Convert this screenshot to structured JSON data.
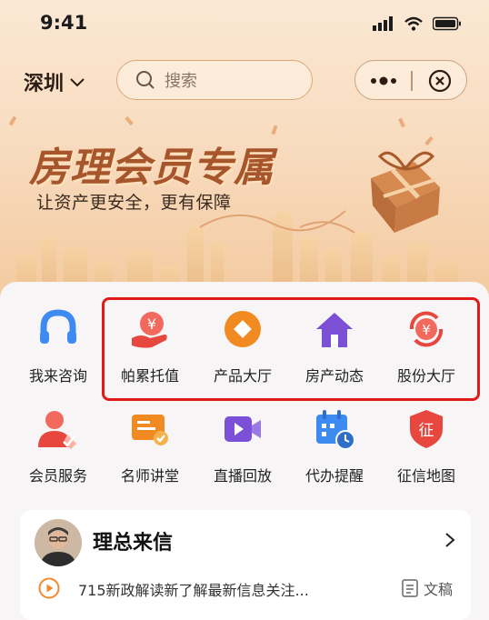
{
  "status_bar": {
    "time": "9:41"
  },
  "header": {
    "city": "深圳",
    "search_placeholder": "搜索"
  },
  "banner": {
    "title": "房理会员专属",
    "subtitle": "让资产更安全，更有保障"
  },
  "menu_row1": [
    {
      "label": "我来咨询",
      "icon": "headset-icon"
    },
    {
      "label": "帕累托值",
      "icon": "coin-hand-icon"
    },
    {
      "label": "产品大厅",
      "icon": "diamond-icon"
    },
    {
      "label": "房产动态",
      "icon": "house-icon"
    },
    {
      "label": "股份大厅",
      "icon": "yen-refresh-icon"
    }
  ],
  "menu_row2": [
    {
      "label": "会员服务",
      "icon": "member-icon"
    },
    {
      "label": "名师讲堂",
      "icon": "lecture-icon"
    },
    {
      "label": "直播回放",
      "icon": "video-icon"
    },
    {
      "label": "代办提醒",
      "icon": "calendar-clock-icon"
    },
    {
      "label": "征信地图",
      "icon": "credit-shield-icon"
    }
  ],
  "letter": {
    "title": "理总来信",
    "news": "715新政解读新了解最新信息关注...",
    "doc_label": "文稿"
  },
  "colors": {
    "accent_orange": "#f08a2c",
    "accent_red": "#e8473f",
    "accent_purple": "#7b4fd6",
    "accent_blue": "#3d8bf0",
    "highlight_red": "#e11a1a"
  }
}
